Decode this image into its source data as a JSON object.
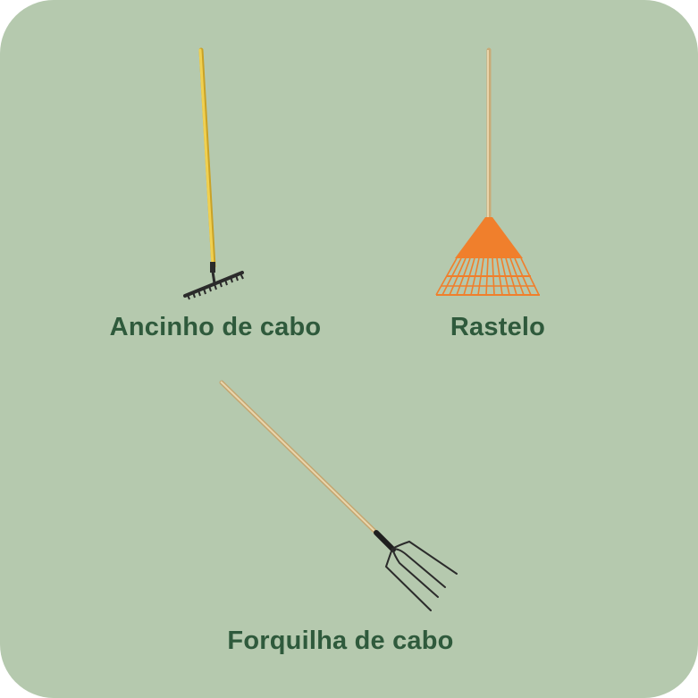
{
  "tools": [
    {
      "id": "ancinho",
      "label": "Ancinho de cabo",
      "icon": "rake-icon"
    },
    {
      "id": "rastelo",
      "label": "Rastelo",
      "icon": "leaf-rake-icon"
    },
    {
      "id": "forquilha",
      "label": "Forquilha de cabo",
      "icon": "pitchfork-icon"
    }
  ],
  "colors": {
    "background": "#b5c9ae",
    "label_text": "#2f5a3c",
    "yellow_handle": "#e8c43a",
    "orange_rake": "#f07f2c",
    "wood_handle": "#dcc08e",
    "metal": "#2b2b2b"
  }
}
